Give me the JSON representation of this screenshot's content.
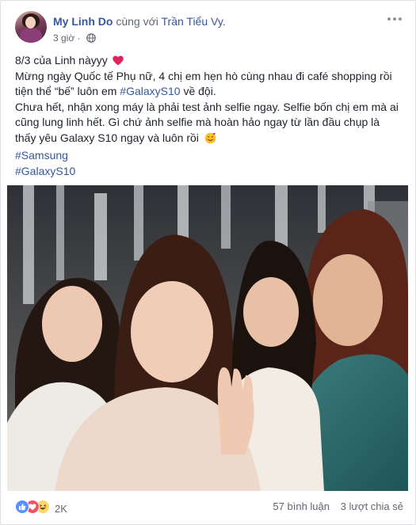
{
  "post": {
    "author": "My Linh Do",
    "with_text": "cùng với",
    "tagged_user": "Trần Tiểu Vy",
    "tagged_suffix": ".",
    "time": "3 giờ",
    "privacy_icon": "globe-icon",
    "text": {
      "line1": "8/3 của Linh nàyyy",
      "line2a": "Mừng ngày Quốc tế Phụ nữ, 4 chị em hẹn hò cùng nhau đi café shopping rồi tiện thể “bế” luôn em ",
      "line2_hashtag": "#GalaxyS10",
      "line2b": " về đội.",
      "line3": "Chưa hết, nhận xong máy là phải test ảnh selfie ngay. Selfie bốn chị em mà ai cũng lung linh hết. Gì chứ ảnh selfie mà hoàn hảo ngay từ lần đầu chụp là thấy yêu Galaxy S10 ngay và luôn rồi",
      "hashtag1": "#Samsung",
      "hashtag2": "#GalaxyS10"
    },
    "photo_icon": "group-selfie-photo"
  },
  "footer": {
    "reaction_icons": [
      "like-icon",
      "love-icon",
      "haha-icon"
    ],
    "reaction_count": "2K",
    "comments": "57 bình luận",
    "shares": "3 lượt chia sẻ"
  },
  "colors": {
    "link": "#365899",
    "text": "#1d2129",
    "meta": "#616770",
    "like": "#5890ff",
    "love": "#f25268",
    "haha": "#fcd669"
  }
}
